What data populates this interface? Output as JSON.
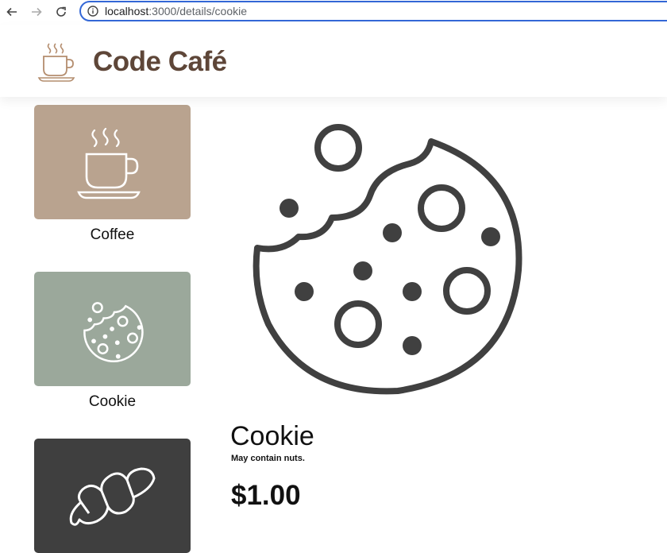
{
  "browser": {
    "url_host": "localhost",
    "url_path": ":3000/details/cookie",
    "icons": [
      "back-arrow-icon",
      "forward-arrow-icon",
      "reload-icon",
      "info-icon"
    ]
  },
  "header": {
    "title": "Code Café",
    "logo_icon": "coffee-cup-icon",
    "title_color": "#5e4638"
  },
  "products": [
    {
      "name": "Coffee",
      "icon": "coffee-cup-icon",
      "tile_color": "#b9a38f"
    },
    {
      "name": "Cookie",
      "icon": "cookie-icon",
      "tile_color": "#9ba89b"
    },
    {
      "name": "",
      "icon": "croissant-icon",
      "tile_color": "#3f3f3f"
    }
  ],
  "detail": {
    "name": "Cookie",
    "description": "May contain nuts.",
    "price": "$1.00",
    "image_icon": "cookie-icon"
  }
}
